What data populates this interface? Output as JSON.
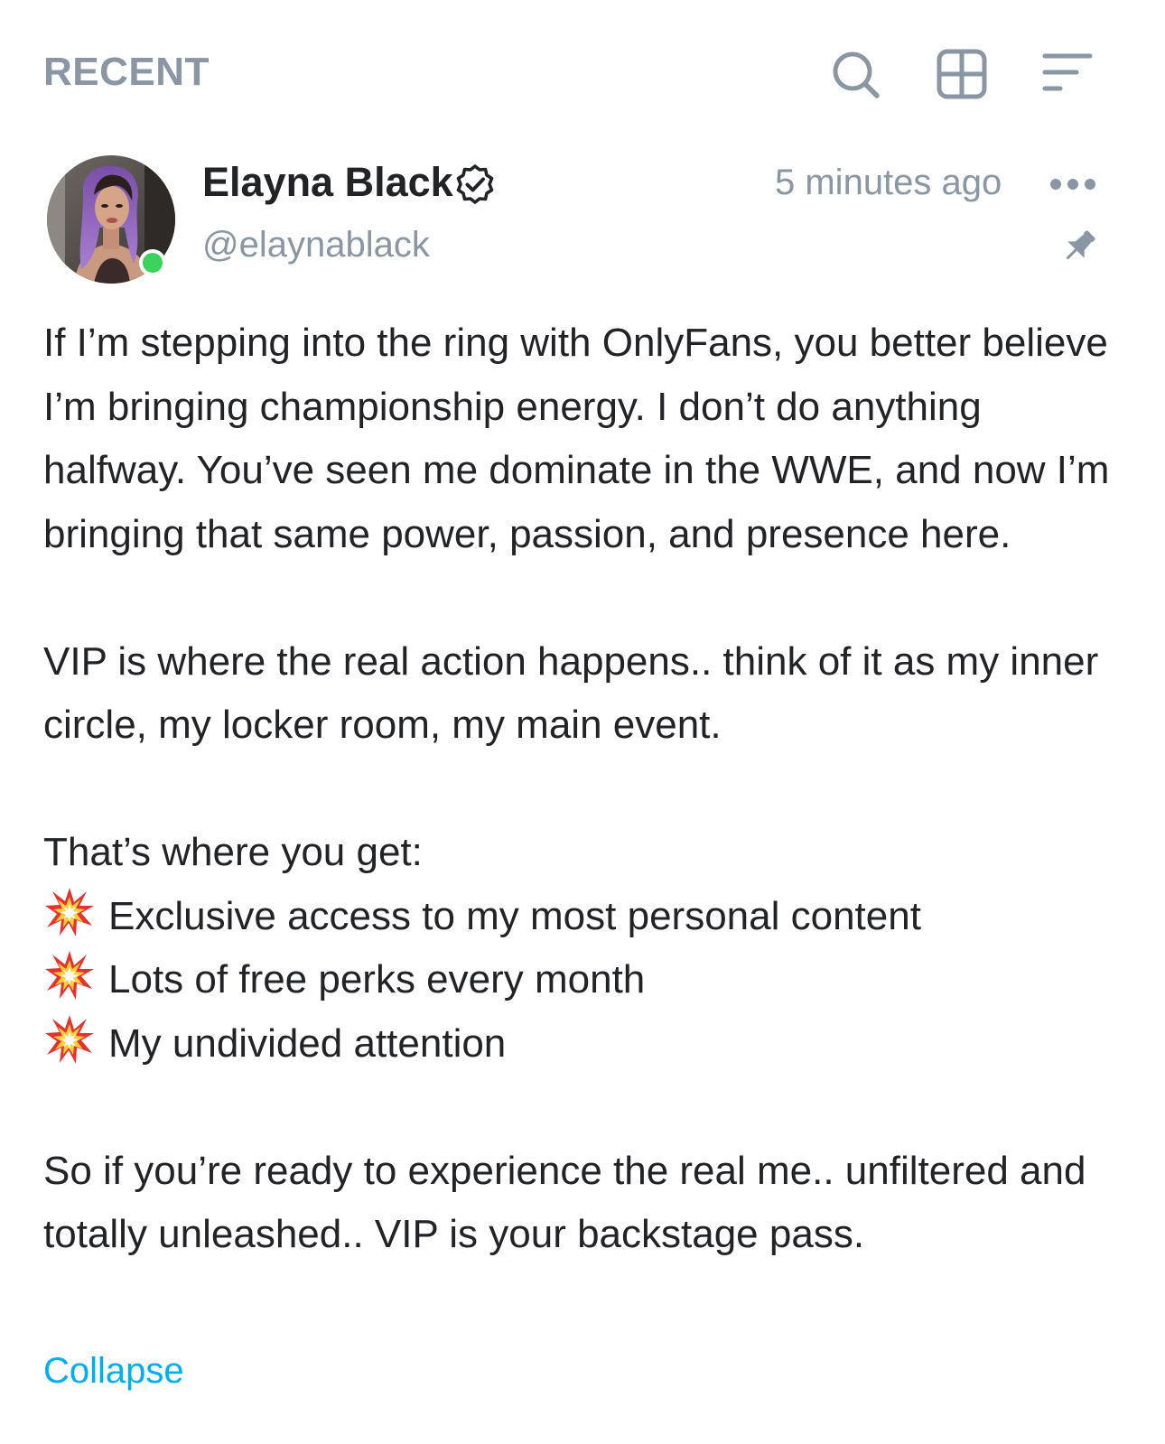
{
  "header": {
    "title": "RECENT",
    "icons": {
      "search": "search-icon",
      "grid": "grid-view-icon",
      "sort": "sort-icon"
    }
  },
  "post": {
    "author": {
      "display_name": "Elayna Black",
      "username": "@elaynablack",
      "verified": true,
      "online": true
    },
    "timestamp": "5 minutes ago",
    "pinned": true,
    "paragraphs": {
      "p1": "If I’m stepping into the ring with OnlyFans, you better believe I’m bringing championship energy. I don’t do anything halfway. You’ve seen me dominate in the WWE, and now I’m bringing that same power, passion, and presence here.",
      "p2": "VIP is where the real action happens.. think of it as my inner circle, my locker room, my main event.",
      "p3_intro": "That’s where you get:",
      "bullets": [
        "Exclusive access to my most personal content",
        "Lots of free perks every month",
        "My undivided attention"
      ],
      "p4": "So if you’re ready to experience the real me.. unfiltered and totally unleashed.. VIP is your backstage pass."
    },
    "collapse_label": "Collapse"
  },
  "colors": {
    "muted": "#8a96a3",
    "text": "#222326",
    "link": "#00aff0",
    "online": "#3cd35a"
  }
}
